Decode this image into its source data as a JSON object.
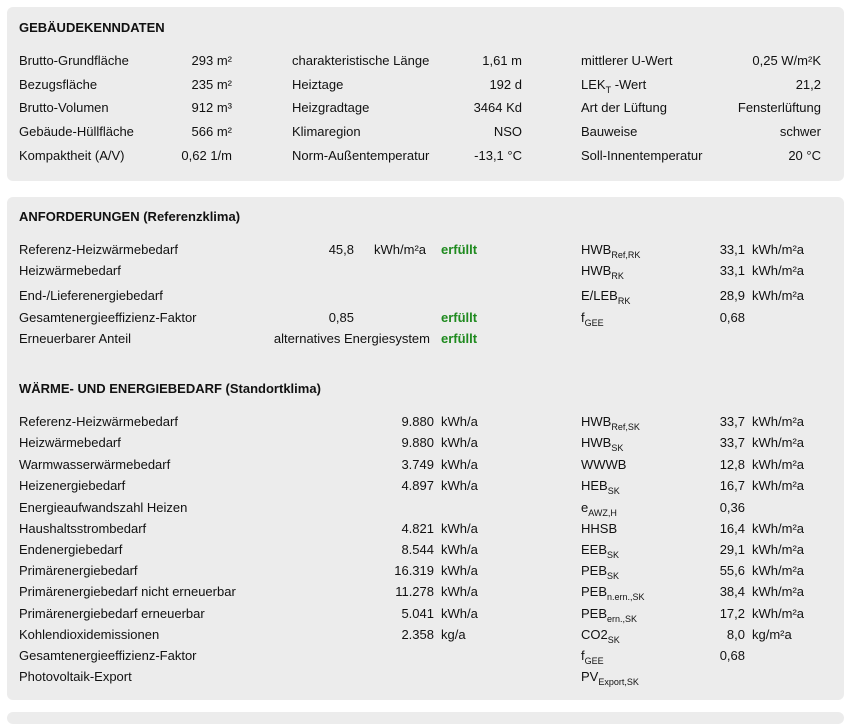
{
  "building": {
    "title": "GEBÄUDEKENNDATEN",
    "col1": [
      {
        "label": "Brutto-Grundfläche",
        "value": "293 m²"
      },
      {
        "label": "Bezugsfläche",
        "value": "235 m²"
      },
      {
        "label": "Brutto-Volumen",
        "value": "912 m³"
      },
      {
        "label": "Gebäude-Hüllfläche",
        "value": "566 m²"
      },
      {
        "label": "Kompaktheit (A/V)",
        "value": "0,62 1/m"
      }
    ],
    "col2": [
      {
        "label": "charakteristische Länge",
        "value": "1,61 m"
      },
      {
        "label": "Heiztage",
        "value": "192 d"
      },
      {
        "label": "Heizgradtage",
        "value": "3464 Kd"
      },
      {
        "label": "Klimaregion",
        "value": "NSO"
      },
      {
        "label": "Norm-Außentemperatur",
        "value": "-13,1 °C"
      }
    ],
    "col3": [
      {
        "label": "mittlerer U-Wert",
        "sub": "",
        "suffix": "",
        "value": "0,25 W/m²K"
      },
      {
        "label": "LEK",
        "sub": "T",
        "suffix": " -Wert",
        "value": "21,2"
      },
      {
        "label": "Art der Lüftung",
        "sub": "",
        "suffix": "",
        "value": "Fensterlüftung"
      },
      {
        "label": "Bauweise",
        "sub": "",
        "suffix": "",
        "value": "schwer"
      },
      {
        "label": "Soll-Innentemperatur",
        "sub": "",
        "suffix": "",
        "value": "20 °C"
      }
    ]
  },
  "requirements": {
    "title": "ANFORDERUNGEN (Referenzklima)",
    "rows": [
      {
        "label": "Referenz-Heizwärmebedarf",
        "value": "45,8",
        "unit": "kWh/m²a",
        "status": "erfüllt",
        "sym": "HWB",
        "sub": "Ref,RK",
        "kval": "33,1",
        "kunit": "kWh/m²a"
      },
      {
        "label": "Heizwärmebedarf",
        "value": "",
        "unit": "",
        "status": "",
        "sym": "HWB",
        "sub": "RK",
        "kval": "33,1",
        "kunit": "kWh/m²a"
      },
      {
        "label": "End-/Lieferenergiebedarf",
        "value": "",
        "unit": "",
        "status": "",
        "sym": "E/LEB",
        "sub": "RK",
        "kval": "28,9",
        "kunit": "kWh/m²a"
      },
      {
        "label": "Gesamtenergieeffizienz-Faktor",
        "value": "0,85",
        "unit": "",
        "status": "erfüllt",
        "sym": "f",
        "sub": "GEE",
        "kval": "0,68",
        "kunit": ""
      },
      {
        "label": "Erneuerbarer Anteil",
        "value": "alternatives Energiesystem",
        "unit": "",
        "status": "erfüllt",
        "sym": "",
        "sub": "",
        "kval": "",
        "kunit": ""
      }
    ]
  },
  "energy": {
    "title": "WÄRME- UND ENERGIEBEDARF (Standortklima)",
    "rows": [
      {
        "label": "Referenz-Heizwärmebedarf",
        "value": "9.880",
        "unit": "kWh/a",
        "sym": "HWB",
        "sub": "Ref,SK",
        "kval": "33,7",
        "kunit": "kWh/m²a"
      },
      {
        "label": "Heizwärmebedarf",
        "value": "9.880",
        "unit": "kWh/a",
        "sym": "HWB",
        "sub": "SK",
        "kval": "33,7",
        "kunit": "kWh/m²a"
      },
      {
        "label": "Warmwasserwärmebedarf",
        "value": "3.749",
        "unit": "kWh/a",
        "sym": "WWWB",
        "sub": "",
        "kval": "12,8",
        "kunit": "kWh/m²a"
      },
      {
        "label": "Heizenergiebedarf",
        "value": "4.897",
        "unit": "kWh/a",
        "sym": "HEB",
        "sub": "SK",
        "kval": "16,7",
        "kunit": "kWh/m²a"
      },
      {
        "label": "Energieaufwandszahl Heizen",
        "value": "",
        "unit": "",
        "sym": "e",
        "sub": "AWZ,H",
        "kval": "0,36",
        "kunit": ""
      },
      {
        "label": "Haushaltsstrombedarf",
        "value": "4.821",
        "unit": "kWh/a",
        "sym": "HHSB",
        "sub": "",
        "kval": "16,4",
        "kunit": "kWh/m²a"
      },
      {
        "label": "Endenergiebedarf",
        "value": "8.544",
        "unit": "kWh/a",
        "sym": "EEB",
        "sub": "SK",
        "kval": "29,1",
        "kunit": "kWh/m²a"
      },
      {
        "label": "Primärenergiebedarf",
        "value": "16.319",
        "unit": "kWh/a",
        "sym": "PEB",
        "sub": "SK",
        "kval": "55,6",
        "kunit": "kWh/m²a"
      },
      {
        "label": "Primärenergiebedarf nicht erneuerbar",
        "value": "11.278",
        "unit": "kWh/a",
        "sym": "PEB",
        "sub": "n.ern.,SK",
        "kval": "38,4",
        "kunit": "kWh/m²a"
      },
      {
        "label": "Primärenergiebedarf erneuerbar",
        "value": "5.041",
        "unit": "kWh/a",
        "sym": "PEB",
        "sub": "ern.,SK",
        "kval": "17,2",
        "kunit": "kWh/m²a"
      },
      {
        "label": "Kohlendioxidemissionen",
        "value": "2.358",
        "unit": "kg/a",
        "sym": "CO2",
        "sub": "SK",
        "kval": "8,0",
        "kunit": "kg/m²a"
      },
      {
        "label": "Gesamtenergieeffizienz-Faktor",
        "value": "",
        "unit": "",
        "sym": "f",
        "sub": "GEE",
        "kval": "0,68",
        "kunit": ""
      },
      {
        "label": "Photovoltaik-Export",
        "value": "",
        "unit": "",
        "sym": "PV",
        "sub": "Export,SK",
        "kval": "",
        "kunit": ""
      }
    ]
  }
}
